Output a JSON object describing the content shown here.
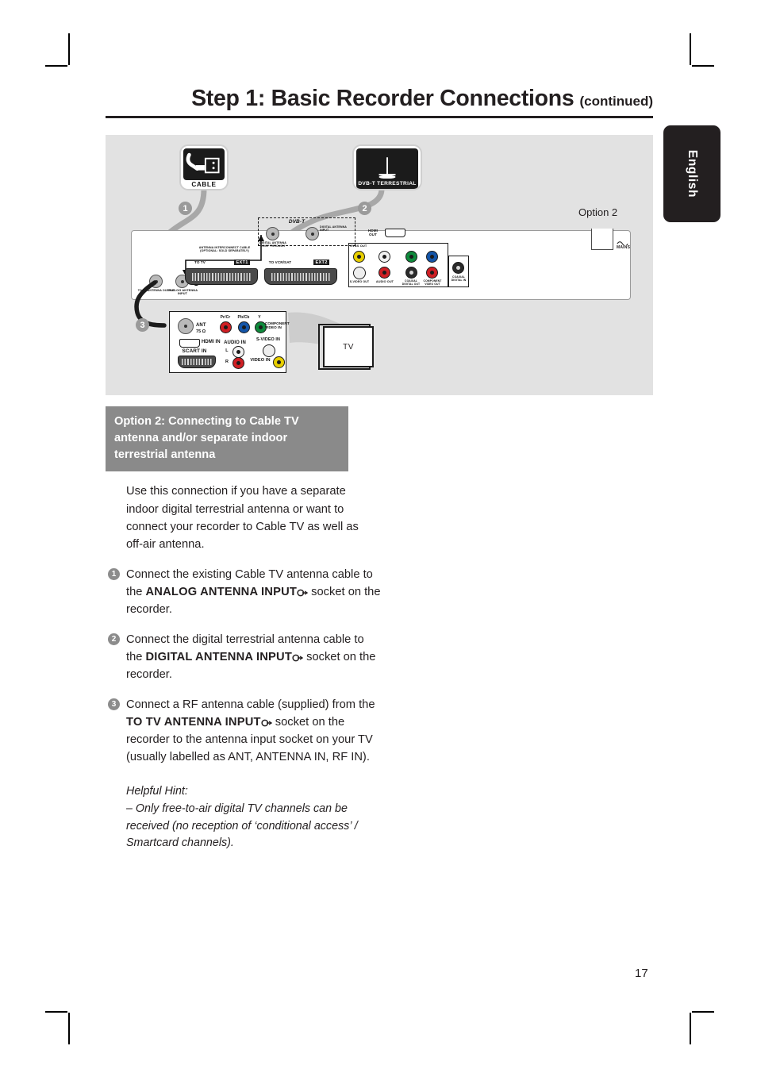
{
  "header": {
    "title_main": "Step 1: Basic Recorder Connections",
    "title_continued": "(continued)"
  },
  "language_tab": {
    "label": "English"
  },
  "page": {
    "number": "17"
  },
  "diagram": {
    "option_label": "Option 2",
    "sources": [
      {
        "id": "cable",
        "caption": "CABLE",
        "badge": "1"
      },
      {
        "id": "dvbt",
        "caption": "DVB-T TERRESTRIAL",
        "badge": "2"
      }
    ],
    "badges": {
      "one": "1",
      "two": "2",
      "three": "3"
    },
    "recorder_rear": {
      "mains": "MAINS",
      "to_tv_antenna": "TO TV ANTENNA OUTPUT",
      "analog_antenna_input": "ANALOG ANTENNA INPUT",
      "antenna_interconnect": "ANTENNA INTERCONNECT CABLE (OPTIONAL: SOLD SEPARATELY)",
      "dvbt_block": "DVB-T",
      "digital_antenna_loop": "DIGITAL ANTENNA LOOP THROUGH",
      "digital_antenna_input": "DIGITAL ANTENNA INPUT",
      "scart1_label": "TO TV",
      "scart1_tag": "EXT1",
      "scart2_label": "TO VCR/SAT",
      "scart2_tag": "EXT2",
      "hdmi_out": "HDMI OUT",
      "cvbs_out": "CVBS OUT",
      "s_video_out": "S-VIDEO OUT",
      "audio_out": "AUDIO OUT",
      "coaxial_digital_out": "COAXIAL DIGITAL OUT",
      "component_video_out": "COMPONENT VIDEO OUT",
      "coaxial_digital_in": "COAXIAL DIGITAL IN"
    },
    "tv_panel": {
      "ant": "ANT",
      "ant_ohm": "75 Ω",
      "pr_cr": "Pr/Cr",
      "pb_cb": "Pb/Cb",
      "y": "Y",
      "component_video_in": "COMPONENT VIDEO IN",
      "hdmi_in": "HDMI IN",
      "s_video_in": "S-VIDEO IN",
      "audio_in": "AUDIO IN",
      "audio_l": "L",
      "audio_r": "R",
      "video_in": "VIDEO IN",
      "scart_in": "SCART IN",
      "tv_label": "TV"
    }
  },
  "content": {
    "option_heading": "Option 2: Connecting to Cable TV antenna and/or separate indoor terrestrial antenna",
    "intro": "Use this connection if you have a separate indoor digital terrestrial antenna or want to connect your recorder to Cable TV as well as off-air antenna.",
    "steps": [
      {
        "num": "1",
        "pre": "Connect the existing Cable TV antenna cable to the ",
        "bold": "ANALOG ANTENNA INPUT",
        "symbol": "↦",
        "post": " socket on the recorder."
      },
      {
        "num": "2",
        "pre": "Connect the digital terrestrial antenna cable to the ",
        "bold": "DIGITAL ANTENNA INPUT",
        "symbol": "↦",
        "post": " socket on the recorder."
      },
      {
        "num": "3",
        "pre": "Connect a RF antenna cable (supplied) from the ",
        "bold": "TO TV ANTENNA INPUT",
        "symbol": "↦",
        "post": " socket on the recorder to the antenna input socket on your TV (usually labelled as ANT, ANTENNA IN, RF IN)."
      }
    ],
    "hint_title": "Helpful Hint:",
    "hint_body": "– Only free-to-air digital TV channels can be received (no reception of ‘conditional access’ / Smartcard channels)."
  },
  "colors": {
    "ink": "#231f20",
    "diagram_bg": "#e2e2e2",
    "heading_bg": "#8a8a8a",
    "badge_gray": "#8c8c8c",
    "tab_black": "#231f20",
    "rca_yellow": "#e8cf00",
    "rca_red": "#cf1f24",
    "rca_green": "#0f8a3c",
    "rca_blue": "#1455a8",
    "rca_white": "#f2f2f2"
  }
}
